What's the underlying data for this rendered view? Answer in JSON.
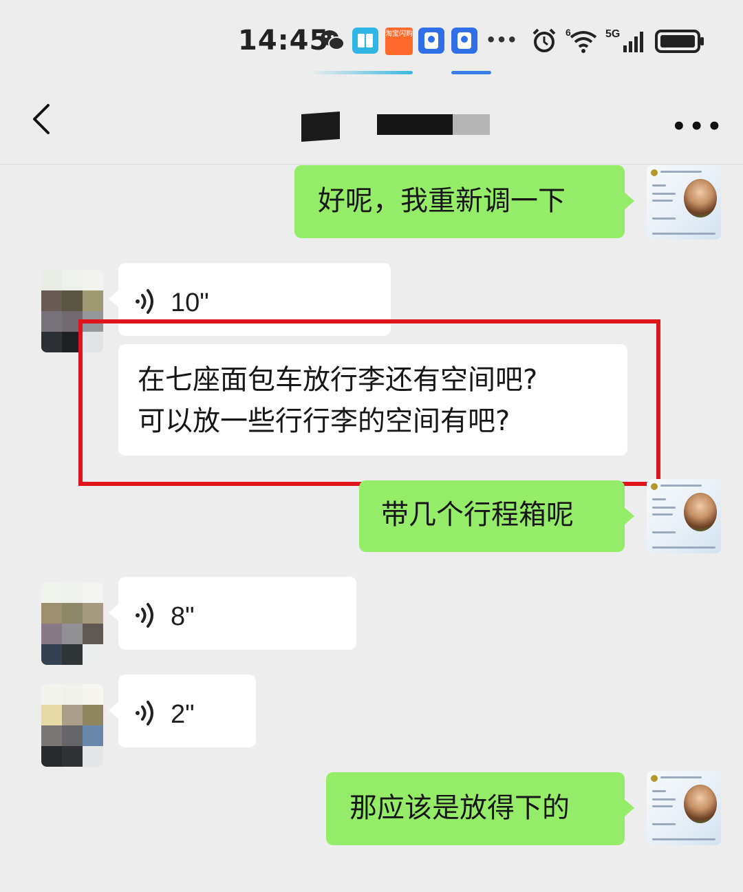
{
  "status_bar": {
    "time": "14:45",
    "taobao_label": "淘宝闪购",
    "signal_label": "5G",
    "wifi_label": "6",
    "icons": [
      "wechat-icon",
      "reader-icon",
      "taobao-icon",
      "app-icon",
      "app-icon",
      "more-icon",
      "alarm-icon",
      "wifi-icon",
      "signal-icon",
      "battery-icon"
    ]
  },
  "nav": {
    "back_label": "<",
    "menu_label": "•••"
  },
  "messages": [
    {
      "side": "me",
      "type": "text",
      "text": "好呢，我重新调一下"
    },
    {
      "side": "them",
      "type": "voice",
      "duration": "10\""
    },
    {
      "side": "them",
      "type": "text",
      "lines": [
        "在七座面包车放行李还有空间吧?",
        "可以放一些行行李的空间有吧?"
      ],
      "highlighted": true
    },
    {
      "side": "me",
      "type": "text",
      "text": "带几个行程箱呢"
    },
    {
      "side": "them",
      "type": "voice",
      "duration": "8\""
    },
    {
      "side": "them",
      "type": "voice",
      "duration": "2\""
    },
    {
      "side": "me",
      "type": "text",
      "text": "那应该是放得下的"
    }
  ],
  "colors": {
    "background": "#ededed",
    "my_bubble": "#95ec69",
    "their_bubble": "#ffffff",
    "highlight": "#e0141c"
  }
}
